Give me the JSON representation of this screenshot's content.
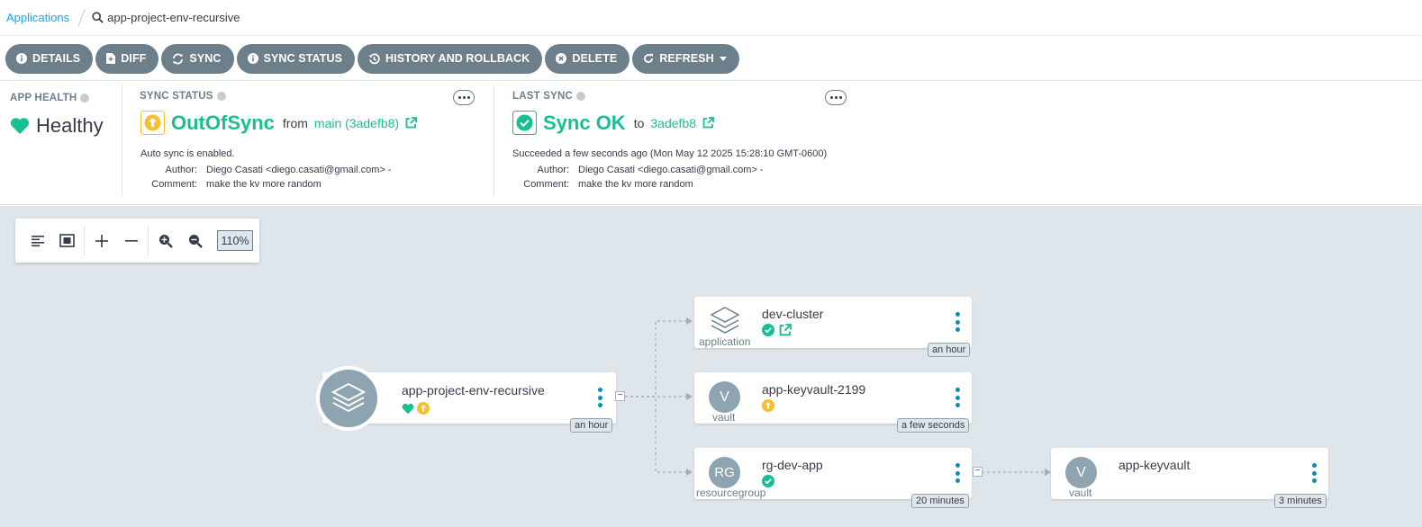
{
  "breadcrumb": {
    "root": "Applications",
    "current": "app-project-env-recursive"
  },
  "toolbar": {
    "details": "DETAILS",
    "diff": "DIFF",
    "sync": "SYNC",
    "sync_status": "SYNC STATUS",
    "history": "HISTORY AND ROLLBACK",
    "delete": "DELETE",
    "refresh": "REFRESH"
  },
  "app_health": {
    "title": "APP HEALTH",
    "status": "Healthy"
  },
  "sync_status": {
    "title": "SYNC STATUS",
    "status": "OutOfSync",
    "from_label": "from",
    "revision": "main (3adefb8)",
    "auto_sync": "Auto sync is enabled.",
    "author_label": "Author:",
    "author": "Diego Casati <diego.casati@gmail.com> -",
    "comment_label": "Comment:",
    "comment": "make the kv more random"
  },
  "last_sync": {
    "title": "LAST SYNC",
    "status": "Sync OK",
    "to_label": "to",
    "revision": "3adefb8",
    "succeeded": "Succeeded a few seconds ago (Mon May 12 2025 15:28:10 GMT-0600)",
    "author_label": "Author:",
    "author": "Diego Casati <diego.casati@gmail.com> -",
    "comment_label": "Comment:",
    "comment": "make the kv more random"
  },
  "graph": {
    "zoom": "110%",
    "root": {
      "name": "app-project-env-recursive",
      "age": "an hour"
    },
    "nodes": [
      {
        "name": "dev-cluster",
        "kind": "application",
        "age": "an hour"
      },
      {
        "name": "app-keyvault-2199",
        "kind": "vault",
        "icon_text": "V",
        "age": "a few seconds"
      },
      {
        "name": "rg-dev-app",
        "kind": "resourcegroup",
        "icon_text": "RG",
        "age": "20 minutes"
      },
      {
        "name": "app-keyvault",
        "kind": "vault",
        "icon_text": "V",
        "age": "3 minutes"
      }
    ]
  },
  "colors": {
    "healthy": "#18be94",
    "out_of_sync": "#f4c030",
    "link": "#0dadea",
    "button": "#6d7f8b",
    "graph_bg": "#dee6eb"
  }
}
